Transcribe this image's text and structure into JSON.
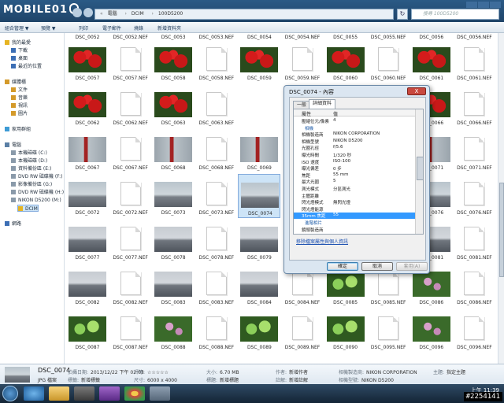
{
  "logo_text": "MOBILE01",
  "address": {
    "segments": [
      "電腦",
      "DCIM",
      "100D5200"
    ],
    "search_placeholder": "搜尋 100D5200"
  },
  "toolbar": {
    "organize": "組合管理 ▼",
    "preview": "預覽 ▼",
    "print": "列印",
    "email": "電子郵件",
    "burn": "燒錄",
    "new_folder": "新增資料夾"
  },
  "sidebar": [
    {
      "label": "我的最愛",
      "indent": 0,
      "icon": "star-icon",
      "color": "#e6b422"
    },
    {
      "label": "下載",
      "indent": 1,
      "icon": "download-icon",
      "color": "#3d6fb5"
    },
    {
      "label": "桌面",
      "indent": 1,
      "icon": "desktop-icon",
      "color": "#3d6fb5"
    },
    {
      "label": "最近的位置",
      "indent": 1,
      "icon": "recent-icon",
      "color": "#3d6fb5"
    },
    {
      "label": "",
      "indent": 0,
      "icon": "",
      "color": ""
    },
    {
      "label": "媒體櫃",
      "indent": 0,
      "icon": "library-icon",
      "color": "#d49a2a"
    },
    {
      "label": "文件",
      "indent": 1,
      "icon": "document-icon",
      "color": "#d49a2a"
    },
    {
      "label": "音樂",
      "indent": 1,
      "icon": "music-icon",
      "color": "#d49a2a"
    },
    {
      "label": "視訊",
      "indent": 1,
      "icon": "video-icon",
      "color": "#d49a2a"
    },
    {
      "label": "圖片",
      "indent": 1,
      "icon": "picture-icon",
      "color": "#d49a2a"
    },
    {
      "label": "",
      "indent": 0,
      "icon": "",
      "color": ""
    },
    {
      "label": "家用群組",
      "indent": 0,
      "icon": "homegroup-icon",
      "color": "#3d9bd5"
    },
    {
      "label": "",
      "indent": 0,
      "icon": "",
      "color": ""
    },
    {
      "label": "電腦",
      "indent": 0,
      "icon": "computer-icon",
      "color": "#5a7fa5"
    },
    {
      "label": "本機磁碟 (C:)",
      "indent": 1,
      "icon": "drive-icon",
      "color": "#8a9aaa"
    },
    {
      "label": "本機磁碟 (D:)",
      "indent": 1,
      "icon": "drive-icon",
      "color": "#8a9aaa"
    },
    {
      "label": "資料備份區 (E:)",
      "indent": 1,
      "icon": "drive-icon",
      "color": "#8a9aaa"
    },
    {
      "label": "DVD RW 磁碟機 (F:)",
      "indent": 1,
      "icon": "dvd-icon",
      "color": "#8a9aaa"
    },
    {
      "label": "影像備份區 (G:)",
      "indent": 1,
      "icon": "drive-icon",
      "color": "#8a9aaa"
    },
    {
      "label": "DVD RW 磁碟機 (H:)",
      "indent": 1,
      "icon": "dvd-icon",
      "color": "#8a9aaa"
    },
    {
      "label": "NIKON D5200 (M:)",
      "indent": 1,
      "icon": "camera-icon",
      "color": "#8a9aaa"
    },
    {
      "label": "DCIM",
      "indent": 2,
      "icon": "folder-icon",
      "color": "#e6b422",
      "selected": true
    },
    {
      "label": "",
      "indent": 0,
      "icon": "",
      "color": ""
    },
    {
      "label": "網路",
      "indent": 0,
      "icon": "network-icon",
      "color": "#3d6fb5"
    }
  ],
  "grid": {
    "top_labels": [
      "DSC_0052",
      "DSC_0052.NEF",
      "DSC_0053",
      "DSC_0053.NEF",
      "DSC_0054",
      "DSC_0054.NEF",
      "DSC_0055",
      "DSC_0055.NEF",
      "DSC_0056",
      "DSC_0056.NEF"
    ],
    "rows": [
      [
        {
          "name": "DSC_0057",
          "kind": "red"
        },
        {
          "name": "DSC_0057.NEF",
          "kind": "doc"
        },
        {
          "name": "DSC_0058",
          "kind": "red"
        },
        {
          "name": "DSC_0058.NEF",
          "kind": "doc"
        },
        {
          "name": "DSC_0059",
          "kind": "red"
        },
        {
          "name": "DSC_0059.NEF",
          "kind": "doc"
        },
        {
          "name": "DSC_0060",
          "kind": "red"
        },
        {
          "name": "DSC_0060.NEF",
          "kind": "doc"
        },
        {
          "name": "DSC_0061",
          "kind": "red"
        },
        {
          "name": "DSC_0061.NEF",
          "kind": "doc"
        }
      ],
      [
        {
          "name": "DSC_0062",
          "kind": "red"
        },
        {
          "name": "DSC_0062.NEF",
          "kind": "doc"
        },
        {
          "name": "DSC_0063",
          "kind": "red"
        },
        {
          "name": "DSC_0063.NEF",
          "kind": "doc"
        },
        {
          "name": "",
          "kind": "hidden"
        },
        {
          "name": "",
          "kind": "hidden"
        },
        {
          "name": "",
          "kind": "hidden"
        },
        {
          "name": "",
          "kind": "hidden"
        },
        {
          "name": "DSC_0066",
          "kind": "red"
        },
        {
          "name": "DSC_0066.NEF",
          "kind": "doc"
        }
      ],
      [
        {
          "name": "DSC_0067",
          "kind": "pole"
        },
        {
          "name": "DSC_0067.NEF",
          "kind": "doc"
        },
        {
          "name": "DSC_0068",
          "kind": "pole"
        },
        {
          "name": "DSC_0068.NEF",
          "kind": "doc"
        },
        {
          "name": "DSC_0069",
          "kind": "pole"
        },
        {
          "name": "",
          "kind": "hidden"
        },
        {
          "name": "",
          "kind": "hidden"
        },
        {
          "name": "",
          "kind": "hidden"
        },
        {
          "name": "DSC_0071",
          "kind": "pole"
        },
        {
          "name": "DSC_0071.NEF",
          "kind": "doc"
        }
      ],
      [
        {
          "name": "DSC_0072",
          "kind": "sky"
        },
        {
          "name": "DSC_0072.NEF",
          "kind": "doc"
        },
        {
          "name": "DSC_0073",
          "kind": "sky"
        },
        {
          "name": "DSC_0073.NEF",
          "kind": "doc"
        },
        {
          "name": "DSC_0074",
          "kind": "sky",
          "selected": true
        },
        {
          "name": "",
          "kind": "hidden"
        },
        {
          "name": "",
          "kind": "hidden"
        },
        {
          "name": "",
          "kind": "hidden"
        },
        {
          "name": "DSC_0076",
          "kind": "sky"
        },
        {
          "name": "DSC_0076.NEF",
          "kind": "doc"
        }
      ],
      [
        {
          "name": "DSC_0077",
          "kind": "city"
        },
        {
          "name": "DSC_0077.NEF",
          "kind": "doc"
        },
        {
          "name": "DSC_0078",
          "kind": "city"
        },
        {
          "name": "DSC_0078.NEF",
          "kind": "doc"
        },
        {
          "name": "DSC_0079",
          "kind": "city"
        },
        {
          "name": "DSC_0079.NEF",
          "kind": "doc"
        },
        {
          "name": "DSC_0080",
          "kind": "city"
        },
        {
          "name": "DSC_0080.NEF",
          "kind": "doc"
        },
        {
          "name": "DSC_0081",
          "kind": "city"
        },
        {
          "name": "DSC_0081.NEF",
          "kind": "doc"
        }
      ],
      [
        {
          "name": "DSC_0082",
          "kind": "city"
        },
        {
          "name": "DSC_0082.NEF",
          "kind": "doc"
        },
        {
          "name": "DSC_0083",
          "kind": "city"
        },
        {
          "name": "DSC_0083.NEF",
          "kind": "doc"
        },
        {
          "name": "DSC_0084",
          "kind": "city"
        },
        {
          "name": "DSC_0084.NEF",
          "kind": "doc"
        },
        {
          "name": "DSC_0085",
          "kind": "green"
        },
        {
          "name": "DSC_0085.NEF",
          "kind": "doc"
        },
        {
          "name": "DSC_0086",
          "kind": "purple"
        },
        {
          "name": "DSC_0086.NEF",
          "kind": "doc"
        }
      ],
      [
        {
          "name": "DSC_0087",
          "kind": "green"
        },
        {
          "name": "DSC_0087.NEF",
          "kind": "doc"
        },
        {
          "name": "DSC_0088",
          "kind": "purple"
        },
        {
          "name": "DSC_0088.NEF",
          "kind": "doc"
        },
        {
          "name": "DSC_0089",
          "kind": "green"
        },
        {
          "name": "DSC_0089.NEF",
          "kind": "doc"
        },
        {
          "name": "DSC_0090",
          "kind": "green"
        },
        {
          "name": "DSC_0095.NEF",
          "kind": "doc"
        },
        {
          "name": "DSC_0096",
          "kind": "purple"
        },
        {
          "name": "DSC_0096.NEF",
          "kind": "doc"
        }
      ]
    ]
  },
  "dialog": {
    "title": "DSC_0074 - 內容",
    "close": "X",
    "tabs": [
      "一般",
      "詳細資料"
    ],
    "col_property": "屬性",
    "col_value": "值",
    "rows": [
      {
        "type": "row",
        "name": "壓縮位元/像素",
        "value": "4"
      },
      {
        "type": "section",
        "name": "相機"
      },
      {
        "type": "row",
        "name": "相機製造商",
        "value": "NIKON CORPORATION"
      },
      {
        "type": "row",
        "name": "相機型號",
        "value": "NIKON D5200"
      },
      {
        "type": "row",
        "name": "光圈孔徑",
        "value": "f/5.6"
      },
      {
        "type": "row",
        "name": "曝光時間",
        "value": "1/320 秒"
      },
      {
        "type": "row",
        "name": "ISO 速度",
        "value": "ISO-100"
      },
      {
        "type": "row",
        "name": "曝光偏差",
        "value": "0 步"
      },
      {
        "type": "row",
        "name": "焦距",
        "value": "55 mm"
      },
      {
        "type": "row",
        "name": "最大光圈",
        "value": "5"
      },
      {
        "type": "row",
        "name": "測光模式",
        "value": "分區測光"
      },
      {
        "type": "row",
        "name": "主體距離",
        "value": ""
      },
      {
        "type": "row",
        "name": "閃光燈模式",
        "value": "無閃光燈"
      },
      {
        "type": "row",
        "name": "閃光燈能源",
        "value": ""
      },
      {
        "type": "row",
        "name": "35mm 焦距",
        "value": "55",
        "selected": true
      },
      {
        "type": "section",
        "name": "進階相片"
      },
      {
        "type": "row",
        "name": "鏡頭製造商",
        "value": ""
      }
    ],
    "remove_link": "移除檔案屬性與個人資訊",
    "ok": "確定",
    "cancel": "取消",
    "apply": "套用(A)"
  },
  "details": {
    "name": "DSC_0074",
    "type": "JPG 檔案",
    "date_label": "拍攝日期:",
    "date_value": "2013/12/22 下午 02:03",
    "tags_label": "標籤:",
    "tags_value": "新增標籤",
    "rating_label": "評等:",
    "rating_value": "☆☆☆☆☆",
    "dims_label": "尺寸:",
    "dims_value": "6000 x 4000",
    "size_label": "大小:",
    "size_value": "6.70 MB",
    "title_label": "標題:",
    "title_value": "新增標題",
    "author_label": "作者:",
    "author_value": "新增作者",
    "comment_label": "註解:",
    "comment_value": "新增註解",
    "maker_label": "相機製造商:",
    "maker_value": "NIKON CORPORATION",
    "model_label": "相機型號:",
    "model_value": "NIKON D5200",
    "subject_label": "主題:",
    "subject_value": "指定主題"
  },
  "taskbar": {
    "time": "上午 11:39",
    "watermark": "#2254141"
  }
}
